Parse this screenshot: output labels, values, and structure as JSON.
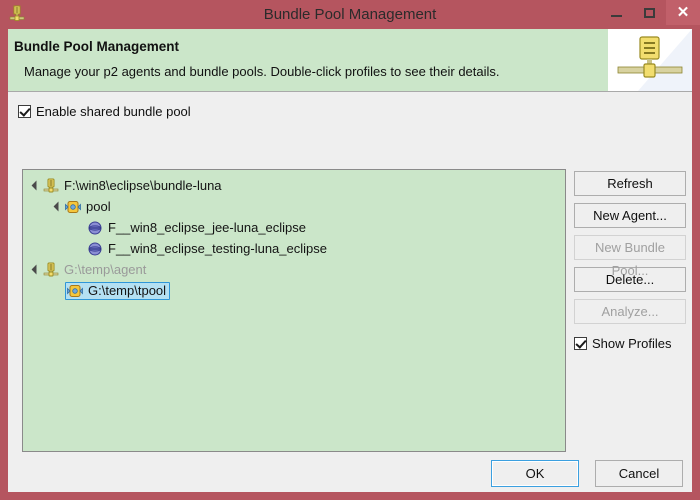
{
  "window": {
    "title": "Bundle Pool Management",
    "icon": "bundle-pool-icon",
    "frame_color": "#b5555f",
    "controls": {
      "minimize": "minimize-icon",
      "maximize": "maximize-icon",
      "close": "close-icon"
    }
  },
  "header": {
    "title": "Bundle Pool Management",
    "description": "Manage your p2 agents and bundle pools. Double-click profiles to see their details.",
    "banner_icon": "bundle-pool-banner-icon",
    "background_color": "#cbe6c9"
  },
  "enable_shared_pool": {
    "label": "Enable shared bundle pool",
    "checked": true
  },
  "tree": {
    "background_color": "#cbe6c9",
    "rows": [
      {
        "label": "F:\\win8\\eclipse\\bundle-luna",
        "indent": 0,
        "icon": "agent-icon",
        "expanded": true,
        "has_twisty": true,
        "dimmed": false,
        "selected": false
      },
      {
        "label": "pool",
        "indent": 1,
        "icon": "pool-icon",
        "expanded": true,
        "has_twisty": true,
        "dimmed": false,
        "selected": false
      },
      {
        "label": "F__win8_eclipse_jee-luna_eclipse",
        "indent": 2,
        "icon": "profile-icon",
        "expanded": false,
        "has_twisty": false,
        "dimmed": false,
        "selected": false
      },
      {
        "label": "F__win8_eclipse_testing-luna_eclipse",
        "indent": 2,
        "icon": "profile-icon",
        "expanded": false,
        "has_twisty": false,
        "dimmed": false,
        "selected": false
      },
      {
        "label": "G:\\temp\\agent",
        "indent": 0,
        "icon": "agent-icon",
        "expanded": true,
        "has_twisty": true,
        "dimmed": true,
        "selected": false
      },
      {
        "label": "G:\\temp\\tpool",
        "indent": 1,
        "icon": "pool-icon",
        "expanded": false,
        "has_twisty": false,
        "dimmed": false,
        "selected": true
      }
    ]
  },
  "side_buttons": [
    {
      "label": "Refresh",
      "enabled": true
    },
    {
      "label": "New Agent...",
      "enabled": true
    },
    {
      "label": "New Bundle Pool...",
      "enabled": false
    },
    {
      "label": "Delete...",
      "enabled": true
    },
    {
      "label": "Analyze...",
      "enabled": false
    }
  ],
  "show_profiles": {
    "label": "Show Profiles",
    "checked": true
  },
  "bottom_buttons": {
    "ok": "OK",
    "cancel": "Cancel"
  }
}
